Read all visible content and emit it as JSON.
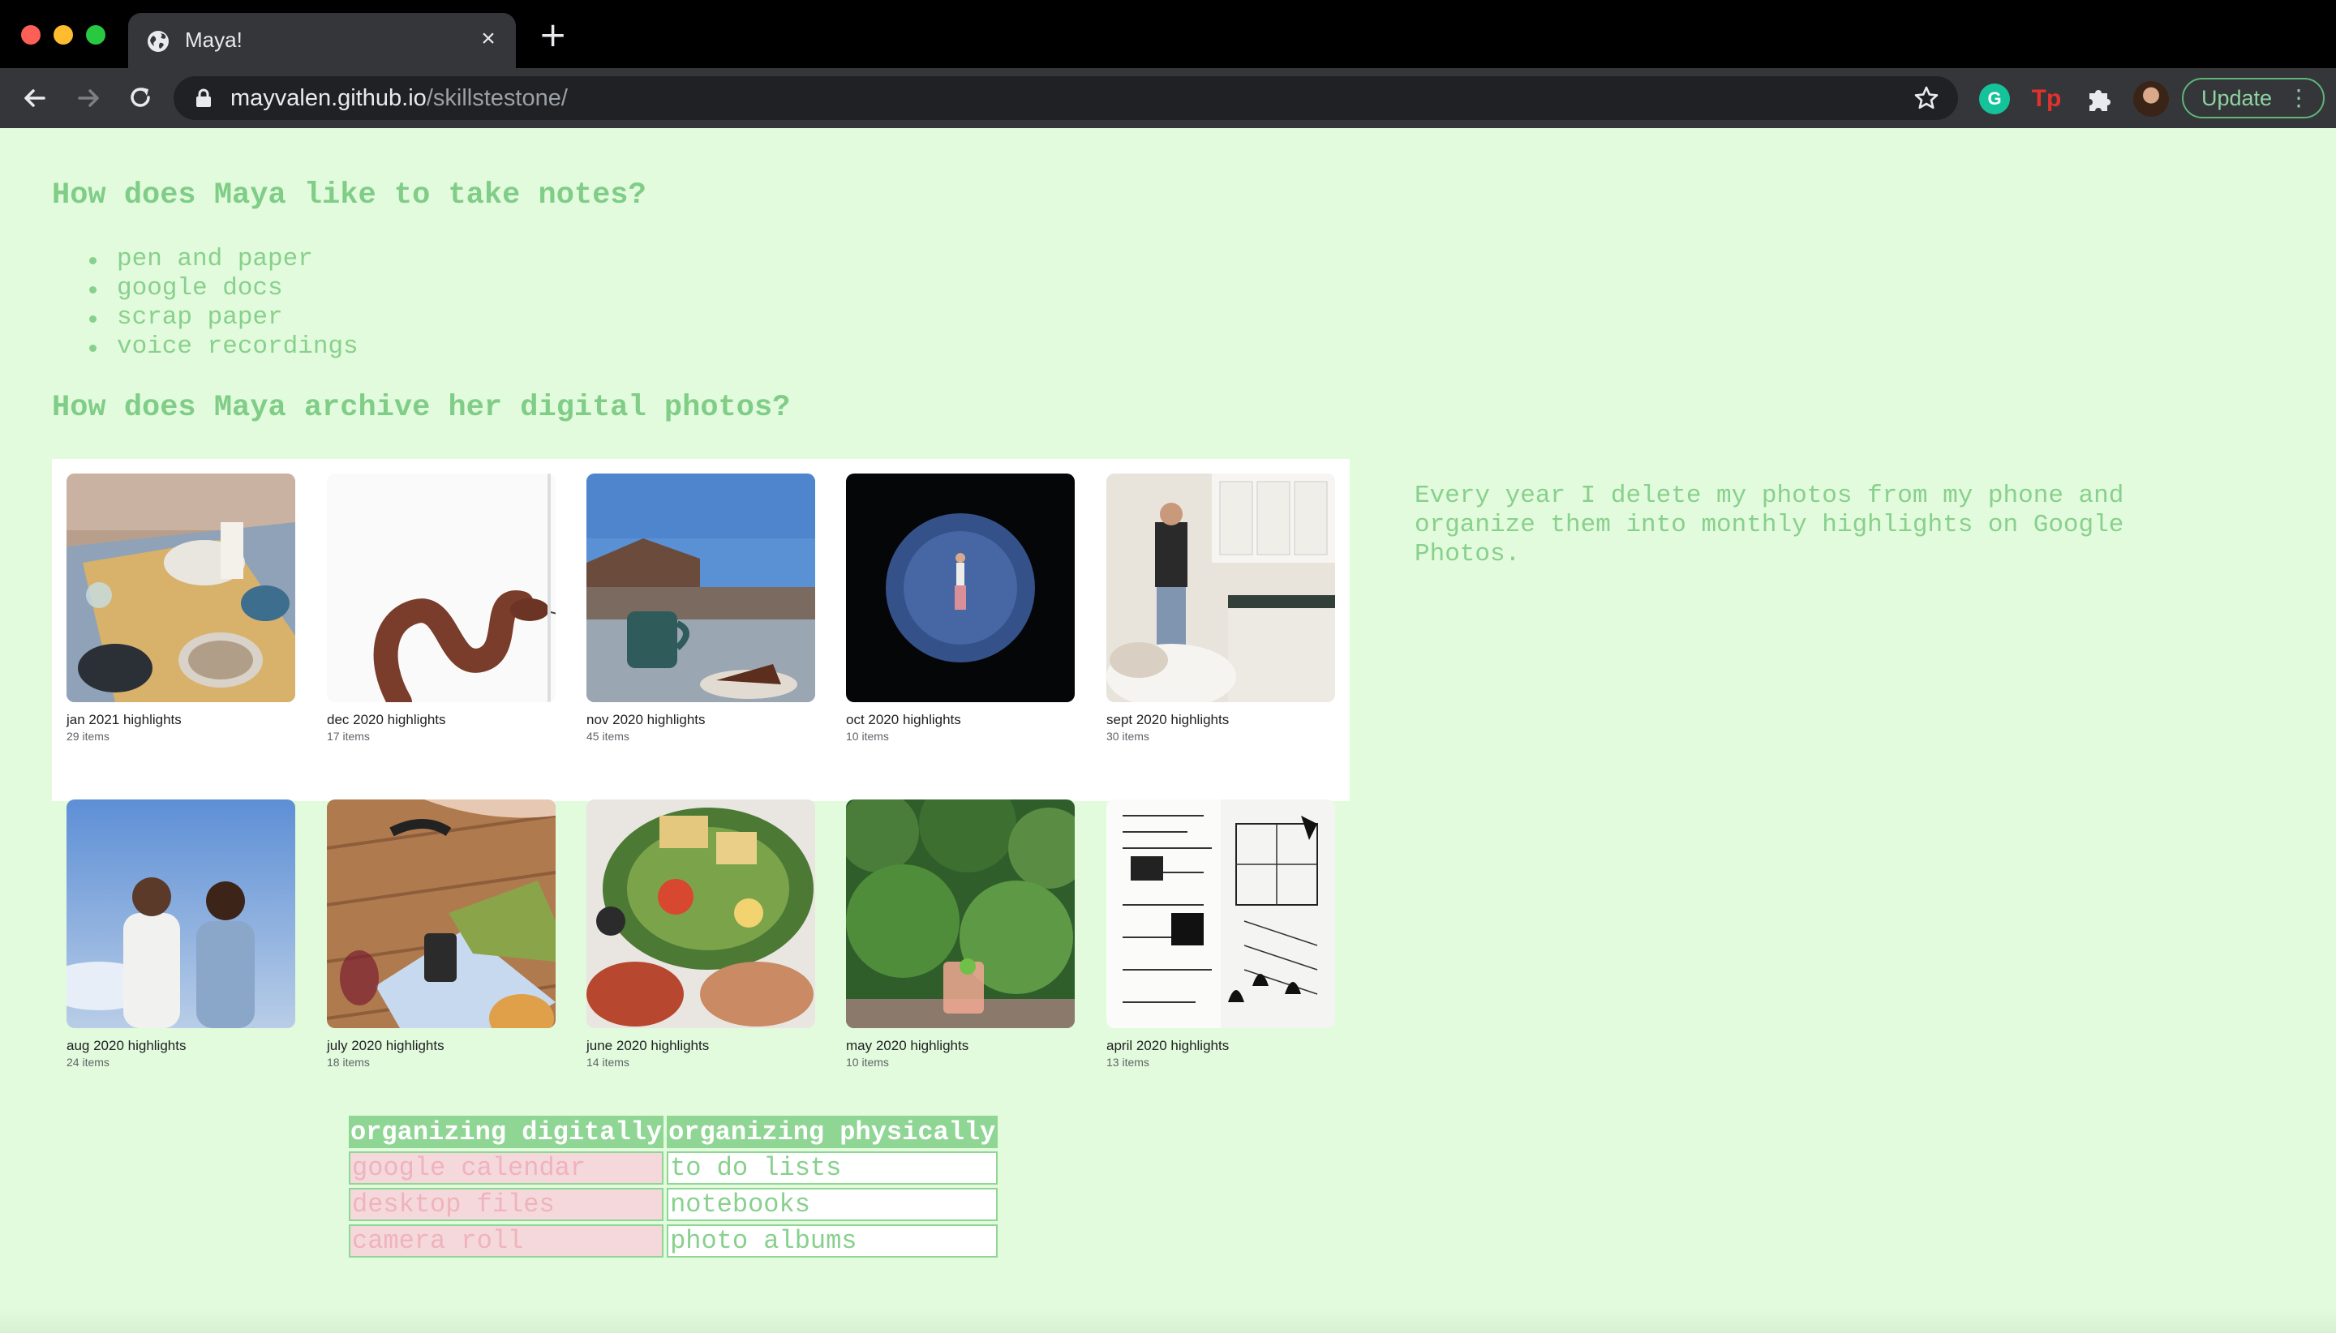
{
  "browser": {
    "tab_title": "Maya!",
    "url_host": "mayvalen.github.io",
    "url_path": "/skillstestone/",
    "update_label": "Update",
    "extension_g": "G",
    "extension_tp": "Tp"
  },
  "page": {
    "notes_heading": "How does Maya like to take notes?",
    "notes_methods": [
      "pen and paper",
      "google docs",
      "scrap paper",
      "voice recordings"
    ],
    "archive_heading": "How does Maya archive her digital photos?",
    "archive_text": "Every year I delete my photos from my phone and organize them into monthly highlights on Google Photos.",
    "albums": [
      {
        "title": "jan 2021 highlights",
        "count": "29 items",
        "thumb": "dinner-table"
      },
      {
        "title": "dec 2020 highlights",
        "count": "17 items",
        "thumb": "snake"
      },
      {
        "title": "nov 2020 highlights",
        "count": "45 items",
        "thumb": "mug-on-deck"
      },
      {
        "title": "oct 2020 highlights",
        "count": "10 items",
        "thumb": "figure-in-circle"
      },
      {
        "title": "sept 2020 highlights",
        "count": "30 items",
        "thumb": "kitchen"
      },
      {
        "title": "aug 2020 highlights",
        "count": "24 items",
        "thumb": "friends-sky"
      },
      {
        "title": "july 2020 highlights",
        "count": "18 items",
        "thumb": "painting-on-deck"
      },
      {
        "title": "june 2020 highlights",
        "count": "14 items",
        "thumb": "food-platter"
      },
      {
        "title": "may 2020 highlights",
        "count": "10 items",
        "thumb": "forest-drink"
      },
      {
        "title": "april 2020 highlights",
        "count": "13 items",
        "thumb": "sketchbook"
      }
    ],
    "table": {
      "headers": [
        "organizing digitally",
        "organizing physically"
      ],
      "rows": [
        [
          "google calendar",
          "to do lists"
        ],
        [
          "desktop files",
          "notebooks"
        ],
        [
          "camera roll",
          "photo albums"
        ]
      ]
    }
  }
}
